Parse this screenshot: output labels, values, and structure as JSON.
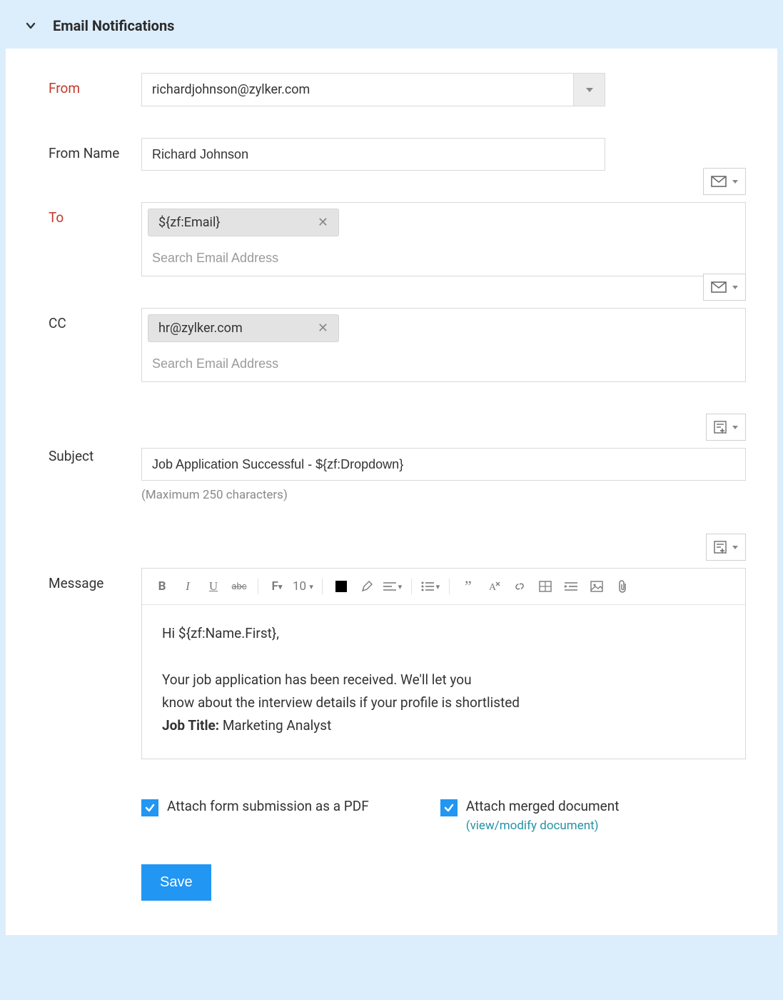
{
  "section_title": "Email Notifications",
  "labels": {
    "from": "From",
    "from_name": "From Name",
    "to": "To",
    "cc": "CC",
    "subject": "Subject",
    "message": "Message"
  },
  "from": {
    "value": "richardjohnson@zylker.com"
  },
  "from_name": {
    "value": "Richard Johnson"
  },
  "to": {
    "tags": [
      "${zf:Email}"
    ],
    "placeholder": "Search Email Address"
  },
  "cc": {
    "tags": [
      "hr@zylker.com"
    ],
    "placeholder": "Search Email Address"
  },
  "subject": {
    "value": "Job Application Successful - ${zf:Dropdown}",
    "hint": "(Maximum 250 characters)"
  },
  "toolbar": {
    "font_size": "10"
  },
  "message": {
    "greeting": "Hi ${zf:Name.First},",
    "body_line1": "Your job application has been received. We'll let you",
    "body_line2": "know about the interview details if your profile is shortlisted",
    "job_title_label": "Job Title:",
    "job_title_value": "Marketing Analyst"
  },
  "attachments": {
    "pdf_label": "Attach form submission as a PDF",
    "pdf_checked": true,
    "merged_label": "Attach merged document",
    "merged_checked": true,
    "merged_link": "(view/modify document)"
  },
  "actions": {
    "save": "Save"
  }
}
